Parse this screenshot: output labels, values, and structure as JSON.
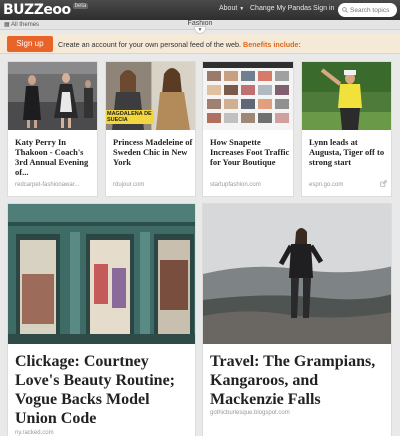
{
  "header": {
    "logo": "BUZZ",
    "logo_suffix": "eoo",
    "logo_badge": "beta",
    "about": "About",
    "change_pandas": "Change My Pandas",
    "sign_in": "Sign in",
    "search_placeholder": "Search topics"
  },
  "theme_bar": {
    "all_themes": "All themes",
    "title": "Fashion"
  },
  "signup": {
    "button": "Sign up",
    "text": "Create an account for your own personal feed of the web.",
    "benefits": "Benefits include:"
  },
  "cards_small": [
    {
      "title": "Katy Perry In Thakoon - Coach's 3rd Annual Evening of...",
      "source": "redcarpet-fashionawar..."
    },
    {
      "title": "Princess Madeleine of Sweden Chic in New York",
      "source": "rdujour.com",
      "image_caption": "MAGDALENA DE SUECIA"
    },
    {
      "title": "How Snapette Increases Foot Traffic for Your Boutique",
      "source": "startupfashion.com"
    },
    {
      "title": "Lynn leads at Augusta, Tiger off to strong start",
      "source": "espn.go.com"
    }
  ],
  "cards_big": [
    {
      "title": "Clickage: Courtney Love's Beauty Routine; Vogue Backs Model Union Code",
      "source": "ny.racked.com"
    },
    {
      "title": "Travel: The Grampians, Kangaroos, and Mackenzie Falls",
      "source": "gothicburlesque.blogspot.com"
    }
  ],
  "colors": {
    "topbar": "#3a3a3a",
    "signup_button": "#e8642a",
    "benefits": "#e0661b"
  }
}
